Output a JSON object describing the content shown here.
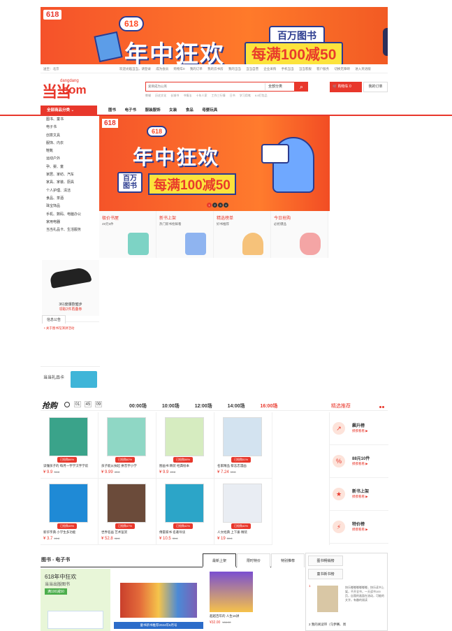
{
  "top_banner": {
    "badge": "618",
    "small_618": "618",
    "headline": "年中狂欢",
    "pill": "百万图书",
    "deal": "每满100减50"
  },
  "top_links": {
    "location": "送至：北京",
    "items": [
      "欢迎光临当当，请登录",
      "成为会员",
      "购物车0",
      "我的订单",
      "我的云书房",
      "我的当当",
      "当当自营",
      "企业采购",
      "手机当当",
      "当当客服",
      "客户服务",
      "切换无障碍",
      "进入英语版"
    ]
  },
  "header": {
    "logo_cn": "当当",
    "logo_en": "dangdang",
    "logo_com": ".com",
    "search_placeholder": "爱目成为公英",
    "search_category": "全部分类",
    "hot_words": [
      "教辅",
      "历史文化",
      "长城书",
      "书情法",
      "十年人家",
      "工作三行情",
      "日书",
      "学习用笔",
      "6.8打包品"
    ],
    "cart": "购物车 0",
    "my_orders": "我的订单"
  },
  "nav": {
    "all_categories": "全部商品分类",
    "items": [
      "图书",
      "电子书",
      "服装服饰",
      "女装",
      "食品",
      "母婴玩具"
    ]
  },
  "categories": [
    "图书、童书",
    "电子书",
    "创意文具",
    "服饰、内衣",
    "鞋靴",
    "运动户外",
    "孕、婴、童",
    "家居、家纺、汽车",
    "家具、家装、厨具",
    "个人护理、清洁",
    "食品、茶酒",
    "珠宝饰品",
    "手机、数码、电脑办公",
    "家用电器",
    "当当礼品卡、生活服务"
  ],
  "main_banner": {
    "badge": "618",
    "small_618": "618",
    "headline": "年中狂欢",
    "pill": "百万图书",
    "deal": "每满100减50",
    "dots": [
      "1",
      "2",
      "3",
      "4"
    ]
  },
  "tiles": [
    {
      "title": "极价书屋",
      "sub": "49元5件",
      "color": "#7dd3c5"
    },
    {
      "title": "新书上架",
      "sub": "热门新书抢鲜看",
      "color": "#8fb4f0"
    },
    {
      "title": "精选榜单",
      "sub": "好书推荐",
      "color": "#f6c27a"
    },
    {
      "title": "今日抢购",
      "sub": "必抢爆品",
      "color": "#f4a5a5"
    }
  ],
  "shoe_promo": {
    "title": "361度爆款健步",
    "sub": "领取2件再叠券"
  },
  "info": {
    "tab": "信息公告",
    "item": "关于图书馆演讲活动"
  },
  "gift_card": {
    "title": "当当礼品卡"
  },
  "flash": {
    "logo": "抢购",
    "time": [
      "01",
      "45",
      "09"
    ],
    "slots": [
      "00:00场",
      "10:00场",
      "12:00场",
      "14:00场",
      "16:00场"
    ],
    "current_slot": "16:00场",
    "recommend": "精选推荐"
  },
  "products": [
    {
      "name": "读懂孩子的 每月一字学汉字学前",
      "tag": "已抢购66%",
      "price": "¥ 9.9",
      "old": "34.8",
      "color": "#3aa38a"
    },
    {
      "name": "孩子能从扶起 拼音字小学",
      "tag": "已抢购62%",
      "price": "¥ 9.99",
      "old": "49.8",
      "color": "#8fd7c5"
    },
    {
      "name": "图画书 精装 经典绘本",
      "tag": "已抢购58%",
      "price": "¥ 9.9",
      "old": "49.8",
      "color": "#d6ecc0"
    },
    {
      "name": "名家精品 蔡志忠漫画",
      "tag": "已抢购51%",
      "price": "¥ 7.24",
      "old": "19.8",
      "color": "#d3e3f0"
    },
    {
      "name": "新华字典 小学生多功能",
      "tag": "已抢购49%",
      "price": "¥ 3.7",
      "old": "15.8",
      "color": "#1f8ad6"
    },
    {
      "name": "世界名画 艺术鉴赏",
      "tag": "已抢购47%",
      "price": "¥ 52.8",
      "old": "98.8",
      "color": "#6b4b3a"
    },
    {
      "name": "傅雷家书 名著导读",
      "tag": "已抢购42%",
      "price": "¥ 10.5",
      "old": "39.8",
      "color": "#2ca5c8"
    },
    {
      "name": "人文经典 上下册 精装",
      "tag": "已抢购40%",
      "price": "¥ 19",
      "old": "59.8",
      "color": "#e9edf3"
    }
  ],
  "ranks": [
    {
      "title": "飙升榜",
      "link": "摸摸看看 ▶",
      "icon": "↗"
    },
    {
      "title": "88元10件",
      "link": "摸摸看看 ▶",
      "icon": "%"
    },
    {
      "title": "新书上架",
      "link": "摸摸看看 ▶",
      "icon": "★"
    },
    {
      "title": "特价榜",
      "link": "摸摸看看 ▶",
      "icon": "⚡"
    }
  ],
  "books": {
    "title": "图书 - 电子书",
    "tabs": [
      "最新上架",
      "限时特价",
      "特别推荐"
    ],
    "promo_a": "618年中狂欢",
    "promo_b": "当当出版图书",
    "promo_c": "满100减50",
    "set_caption": "童书新书推荐2024年6月号",
    "single_name": "超越百年的 人生16讲",
    "single_price": "¥32.00",
    "single_old": "¥66.00",
    "side_tabs": [
      "图书畅销榜",
      "童书新书榜"
    ],
    "side_rank1": "1",
    "side_text": "快乐嘟嘟嘟嘟嘟嘟，快乐读书上架，不开全书，一天读书100页，自我的画面在流动，可能的文字，有趣的阅读",
    "side_item2": "2 我的阅读带（乌伊赛、周"
  }
}
